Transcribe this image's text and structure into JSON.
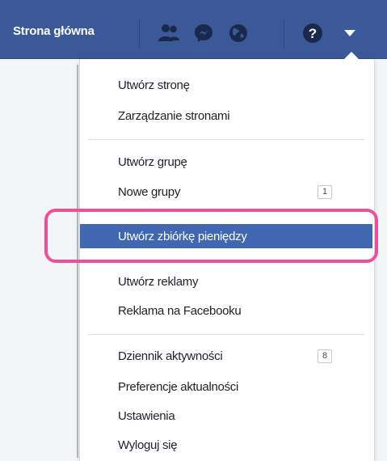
{
  "topbar": {
    "home_label": "Strona główna",
    "icons": [
      "friends-icon",
      "messenger-icon",
      "notifications-globe-icon",
      "help-icon",
      "account-menu-chevron-icon"
    ],
    "color": "#3b5998"
  },
  "menu": {
    "sections": [
      {
        "items": [
          {
            "label": "Utwórz stronę"
          },
          {
            "label": "Zarządzanie stronami"
          }
        ]
      },
      {
        "items": [
          {
            "label": "Utwórz grupę"
          },
          {
            "label": "Nowe grupy",
            "badge": "1"
          },
          {
            "label": "Utwórz zbiórkę pieniędzy",
            "highlighted": true
          },
          {
            "label": "Utwórz reklamy"
          },
          {
            "label": "Reklama na Facebooku"
          }
        ]
      },
      {
        "items": [
          {
            "label": "Dziennik aktywności",
            "badge": "8"
          },
          {
            "label": "Preferencje aktualności"
          },
          {
            "label": "Ustawienia"
          },
          {
            "label": "Wyloguj się"
          }
        ]
      }
    ],
    "highlight_color": "#4267b2",
    "focus_ring_color": "#ef4f98"
  }
}
